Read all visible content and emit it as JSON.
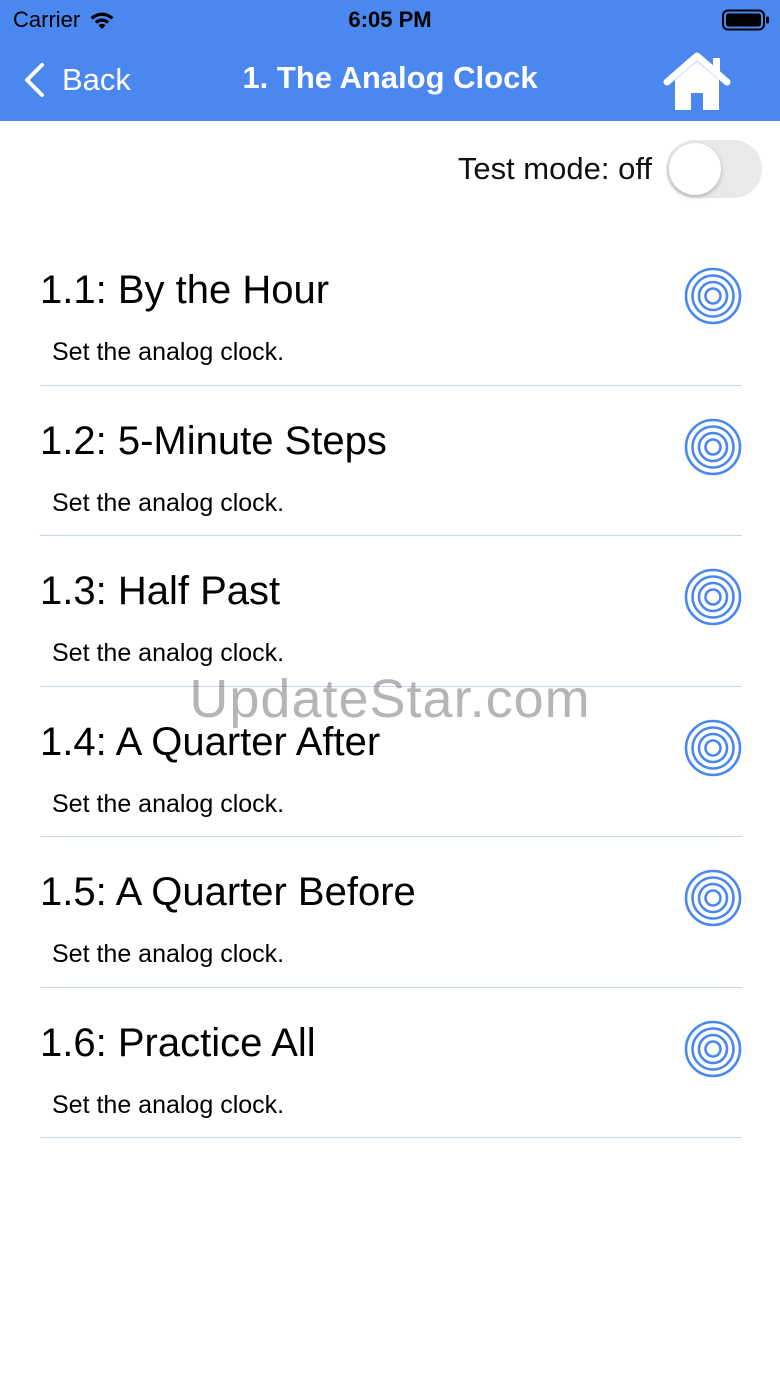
{
  "status_bar": {
    "carrier": "Carrier",
    "time": "6:05 PM",
    "wifi_icon": "wifi-icon",
    "battery_icon": "battery-icon"
  },
  "nav_bar": {
    "back_label": "Back",
    "title": "1. The Analog Clock",
    "home_icon": "home-icon",
    "background_color": "#4a88f0"
  },
  "test_mode": {
    "label": "Test mode: off",
    "enabled": false
  },
  "lessons": [
    {
      "title": "1.1: By the Hour",
      "subtitle": "Set the analog clock.",
      "icon": "target-icon"
    },
    {
      "title": "1.2: 5-Minute Steps",
      "subtitle": "Set the analog clock.",
      "icon": "target-icon"
    },
    {
      "title": "1.3: Half Past",
      "subtitle": "Set the analog clock.",
      "icon": "target-icon"
    },
    {
      "title": "1.4: A Quarter After",
      "subtitle": "Set the analog clock.",
      "icon": "target-icon"
    },
    {
      "title": "1.5: A Quarter Before",
      "subtitle": "Set the analog clock.",
      "icon": "target-icon"
    },
    {
      "title": "1.6: Practice All",
      "subtitle": "Set the analog clock.",
      "icon": "target-icon"
    }
  ],
  "accent_color": "#4a88f0",
  "watermark": "UpdateStar.com"
}
